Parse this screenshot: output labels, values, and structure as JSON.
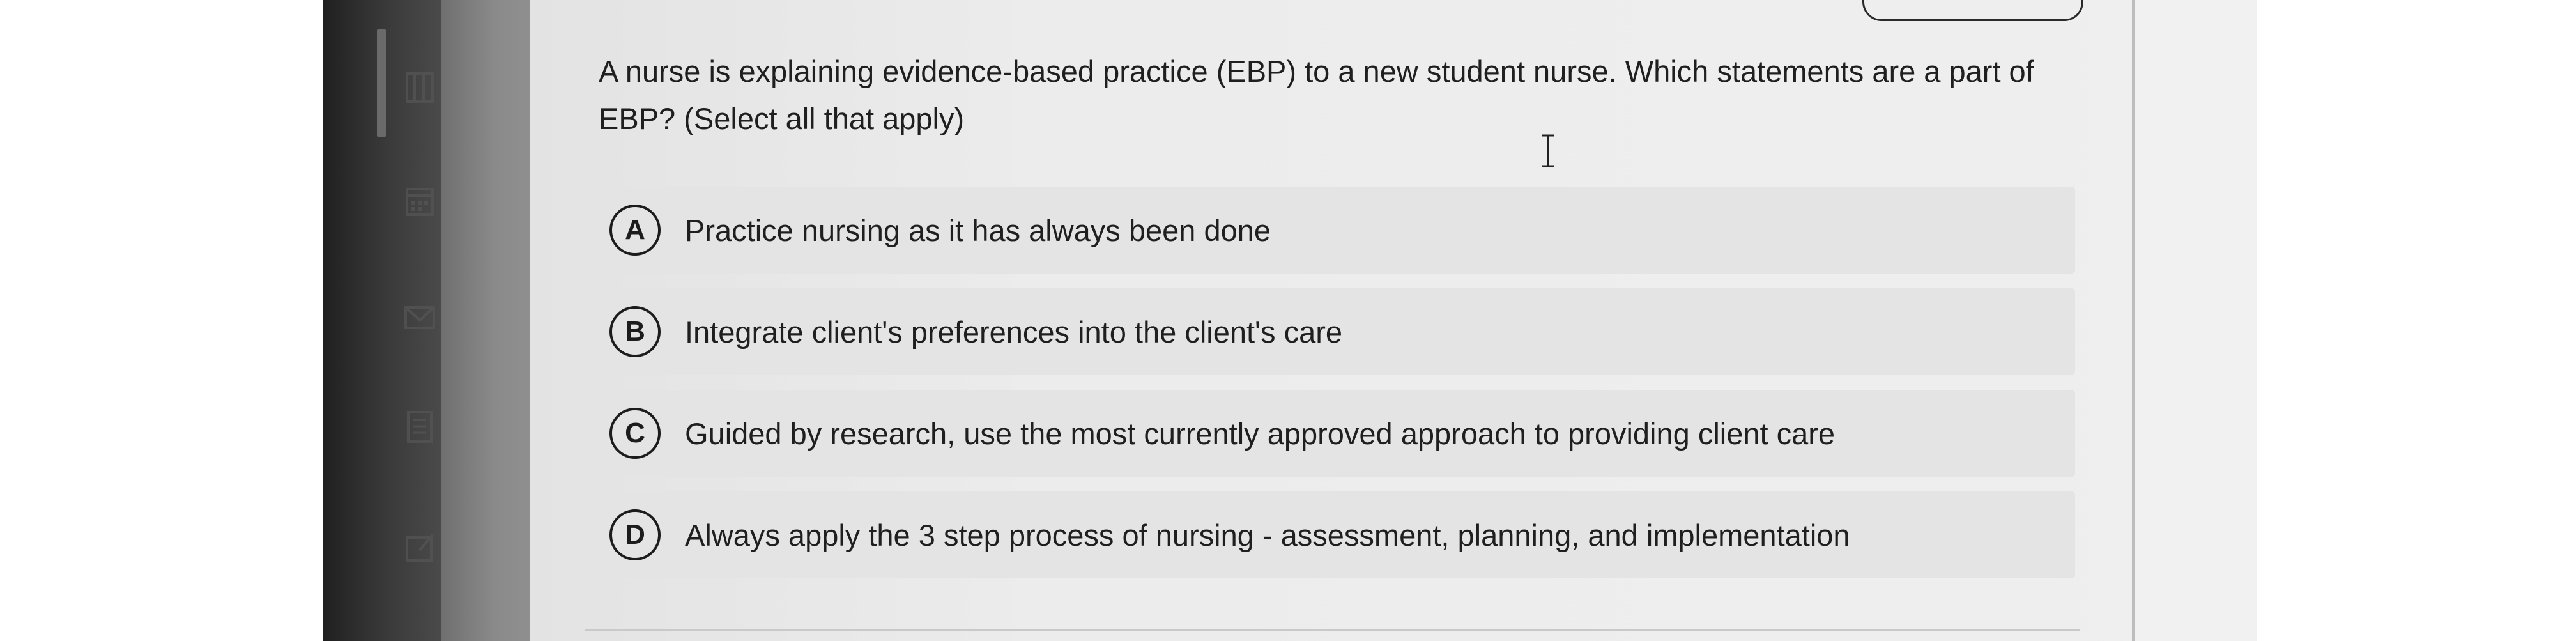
{
  "question": {
    "text": "A nurse is explaining evidence-based practice (EBP) to a new student nurse. Which statements are a part of EBP? (Select all that apply)"
  },
  "options": [
    {
      "letter": "A",
      "text": "Practice nursing as it has always been done"
    },
    {
      "letter": "B",
      "text": "Integrate client's preferences into the client's care"
    },
    {
      "letter": "C",
      "text": "Guided by research, use the most currently approved approach to providing client care"
    },
    {
      "letter": "D",
      "text": "Always apply the 3 step process of nursing - assessment, planning, and implementation"
    }
  ],
  "sidebar": {
    "icons": [
      "book-icon",
      "calendar-icon",
      "mail-icon",
      "notes-icon",
      "edit-icon"
    ]
  },
  "colors": {
    "page_bg": "#ececec",
    "option_bg": "#e4e4e4",
    "text": "#1f1f1f",
    "sidebar": "#8a8a8a"
  }
}
